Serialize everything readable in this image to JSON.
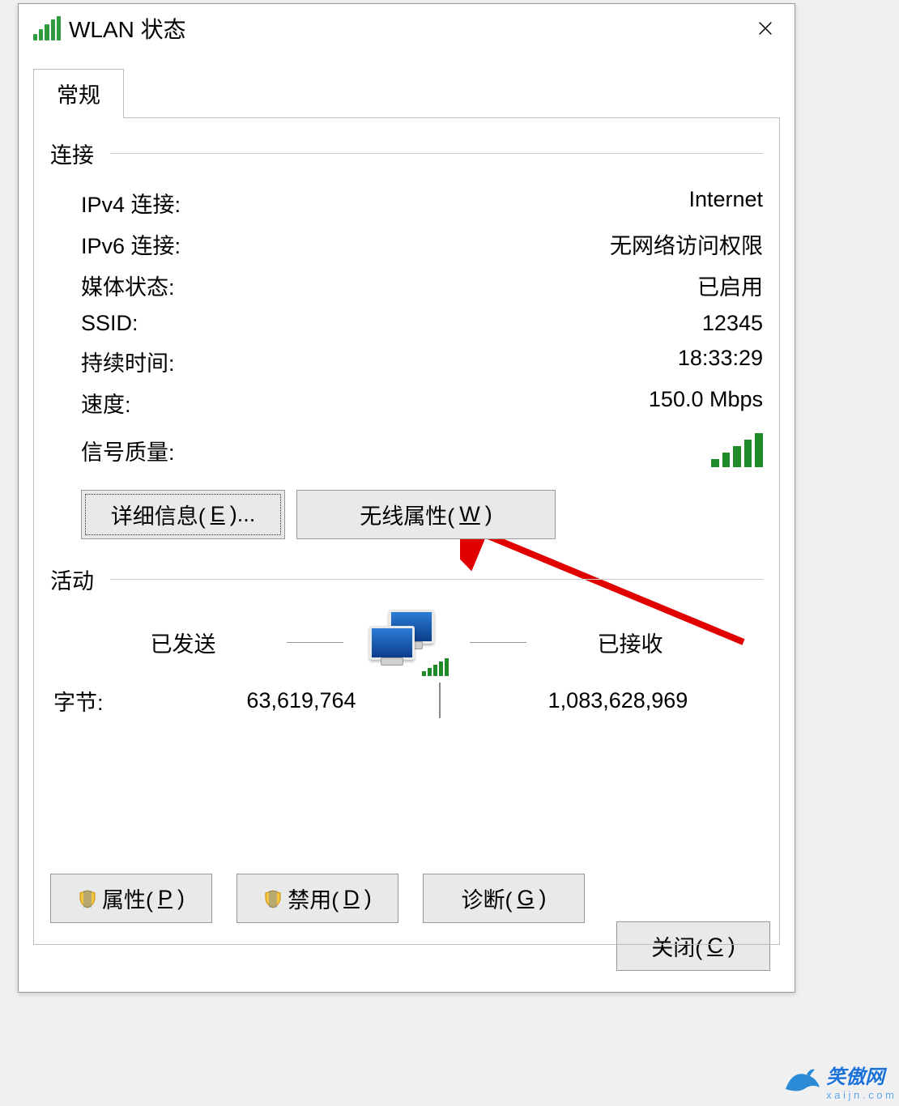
{
  "title": "WLAN 状态",
  "tab": {
    "label": "常规"
  },
  "connection": {
    "section_label": "连接",
    "rows": {
      "ipv4": {
        "label": "IPv4 连接:",
        "value": "Internet"
      },
      "ipv6": {
        "label": "IPv6 连接:",
        "value": "无网络访问权限"
      },
      "media": {
        "label": "媒体状态:",
        "value": "已启用"
      },
      "ssid": {
        "label": "SSID:",
        "value": "12345"
      },
      "duration": {
        "label": "持续时间:",
        "value": "18:33:29"
      },
      "speed": {
        "label": "速度:",
        "value": "150.0 Mbps"
      },
      "signal_label": "信号质量:"
    },
    "buttons": {
      "details_prefix": "详细信息(",
      "details_key": "E",
      "details_suffix": ")...",
      "wireless_prefix": "无线属性(",
      "wireless_key": "W",
      "wireless_suffix": ")"
    }
  },
  "activity": {
    "section_label": "活动",
    "sent_label": "已发送",
    "recv_label": "已接收",
    "bytes_label": "字节:",
    "sent_value": "63,619,764",
    "recv_value": "1,083,628,969"
  },
  "buttons": {
    "properties_prefix": "属性(",
    "properties_key": "P",
    "properties_suffix": ")",
    "disable_prefix": "禁用(",
    "disable_key": "D",
    "disable_suffix": ")",
    "diagnose_prefix": "诊断(",
    "diagnose_key": "G",
    "diagnose_suffix": ")",
    "close_prefix": "关闭(",
    "close_key": "C",
    "close_suffix": ")"
  },
  "watermark": {
    "text": "笑傲网",
    "sub": "x a i j n . c o m"
  }
}
